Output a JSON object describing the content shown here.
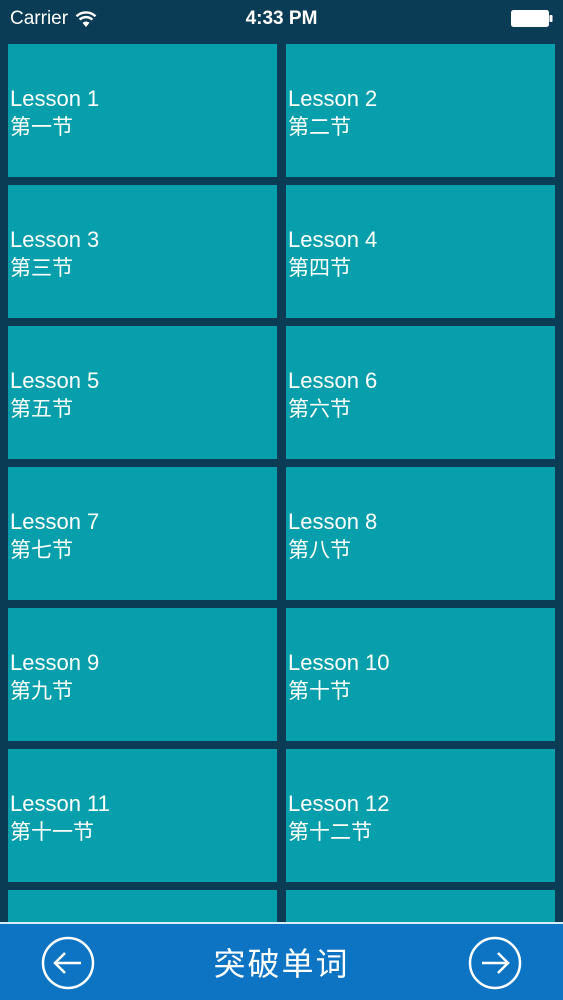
{
  "status_bar": {
    "carrier": "Carrier",
    "time": "4:33 PM"
  },
  "lessons": [
    {
      "en": "Lesson 1",
      "zh": "第一节"
    },
    {
      "en": "Lesson 2",
      "zh": "第二节"
    },
    {
      "en": "Lesson 3",
      "zh": "第三节"
    },
    {
      "en": "Lesson 4",
      "zh": "第四节"
    },
    {
      "en": "Lesson 5",
      "zh": "第五节"
    },
    {
      "en": "Lesson 6",
      "zh": "第六节"
    },
    {
      "en": "Lesson 7",
      "zh": "第七节"
    },
    {
      "en": "Lesson 8",
      "zh": "第八节"
    },
    {
      "en": "Lesson 9",
      "zh": "第九节"
    },
    {
      "en": "Lesson 10",
      "zh": "第十节"
    },
    {
      "en": "Lesson 11",
      "zh": "第十一节"
    },
    {
      "en": "Lesson 12",
      "zh": "第十二节"
    },
    {
      "en": "",
      "zh": ""
    },
    {
      "en": "",
      "zh": ""
    }
  ],
  "bottom_bar": {
    "title": "突破单词",
    "prev_icon": "arrow-left-circle-icon",
    "next_icon": "arrow-right-circle-icon"
  },
  "colors": {
    "background": "#0b3c55",
    "tile": "#079fab",
    "bottom_bar": "#0d74c3",
    "text": "#ffffff"
  }
}
